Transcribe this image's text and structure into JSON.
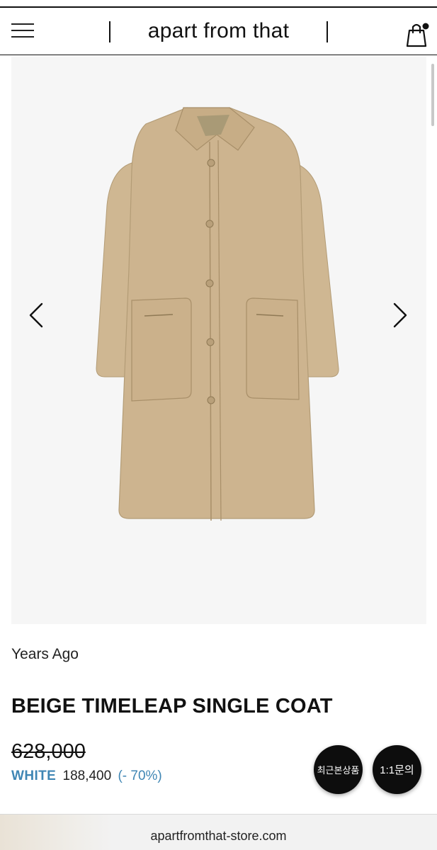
{
  "header": {
    "brand": "apart from that",
    "menu_icon": "hamburger-menu-icon",
    "bag_icon": "shopping-bag-icon",
    "bag_has_notification": true
  },
  "gallery": {
    "image_subject": "beige single-breasted coat",
    "prev_icon": "chevron-left-icon",
    "next_icon": "chevron-right-icon",
    "background_color": "#f6f6f6",
    "coat_color": "#cdb48f"
  },
  "product": {
    "brand_name": "Years Ago",
    "title": "BEIGE TIMELEAP SINGLE COAT",
    "original_price": "628,000",
    "sale_label": "WHITE",
    "sale_price": "188,400",
    "discount": "(- 70%)",
    "accent_color": "#3f86b4"
  },
  "floating_buttons": {
    "recent": "최근본상품",
    "inquiry": "1:1문의"
  },
  "footer": {
    "url": "apartfromthat-store.com"
  }
}
